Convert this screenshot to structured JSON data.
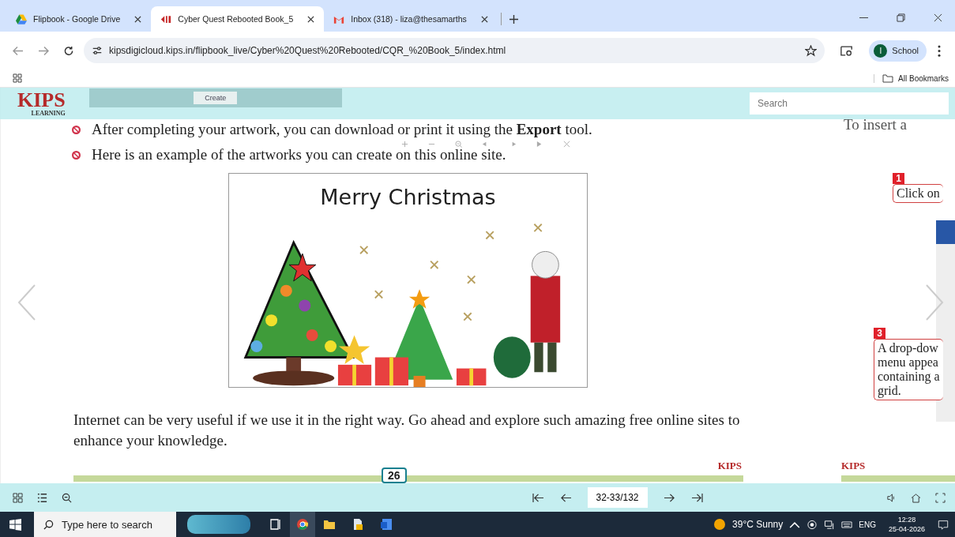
{
  "browser": {
    "tabs": [
      {
        "title": "Flipbook - Google Drive",
        "selected": false
      },
      {
        "title": "Cyber Quest Rebooted Book_5",
        "selected": true
      },
      {
        "title": "Inbox (318) - liza@thesamarths",
        "selected": false
      }
    ],
    "address": "kipsdigicloud.kips.in/flipbook_live/Cyber%20Quest%20Rebooted/CQR_%20Book_5/index.html",
    "profile": {
      "initial": "I",
      "name": "School"
    },
    "bookmarks": "All Bookmarks"
  },
  "flipbook": {
    "logo": {
      "name": "KIPS",
      "tagline": "LEARNING"
    },
    "toolbar_button": "Create",
    "search": {
      "placeholder": "Search"
    },
    "left_page": {
      "bullets": [
        "After completing your artwork, you can download or print it using the **Export** tool.",
        "Here is an example of the artworks you can create on this online site."
      ],
      "artwork": {
        "title": "Merry Christmas"
      },
      "paragraph": "Internet can be very useful if we use it in the right way. Go ahead and explore such amazing free online sites to enhance your knowledge.",
      "page_number": "26",
      "footer_logo": "KIPS"
    },
    "right_page": {
      "intro": "To insert a",
      "callouts": [
        {
          "number": "1",
          "lines": [
            "Click on"
          ]
        },
        {
          "number": "3",
          "lines": [
            "A drop-dow",
            "menu appea",
            "containing a",
            "grid."
          ]
        }
      ],
      "footer_logo": "KIPS"
    },
    "page_field": "32-33/132"
  },
  "taskbar": {
    "search_placeholder": "Type here to search",
    "weather": "39°C Sunny",
    "language": "ENG",
    "time": "12:28",
    "date": "25-04-2026"
  }
}
